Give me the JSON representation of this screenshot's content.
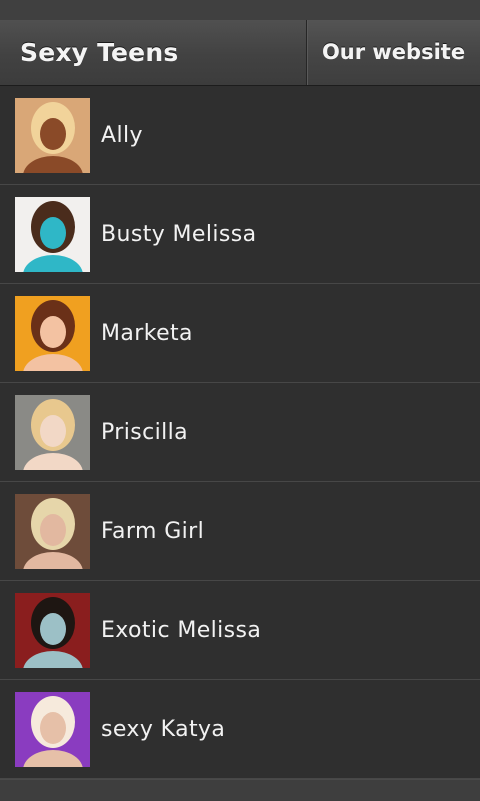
{
  "header": {
    "title": "Sexy Teens",
    "website_label": "Our website"
  },
  "list": {
    "items": [
      {
        "label": "Ally",
        "thumb_bg": "#d9a777",
        "thumb_fg": "#f1d39a",
        "thumb_accent": "#8a4a28"
      },
      {
        "label": "Busty Melissa",
        "thumb_bg": "#f2f0ee",
        "thumb_fg": "#4a2c1c",
        "thumb_accent": "#2fb7c7"
      },
      {
        "label": "Marketa",
        "thumb_bg": "#f0a020",
        "thumb_fg": "#6a3018",
        "thumb_accent": "#f3c2a2"
      },
      {
        "label": "Priscilla",
        "thumb_bg": "#8a8a86",
        "thumb_fg": "#e8c88e",
        "thumb_accent": "#f2d8c6"
      },
      {
        "label": "Farm Girl",
        "thumb_bg": "#6e4c3a",
        "thumb_fg": "#e6d6aa",
        "thumb_accent": "#e2b8a0"
      },
      {
        "label": "Exotic Melissa",
        "thumb_bg": "#8a1e1e",
        "thumb_fg": "#1e1612",
        "thumb_accent": "#9cc0c6"
      },
      {
        "label": "sexy Katya",
        "thumb_bg": "#8a3cc0",
        "thumb_fg": "#f6eadc",
        "thumb_accent": "#e6c0a8"
      }
    ]
  }
}
